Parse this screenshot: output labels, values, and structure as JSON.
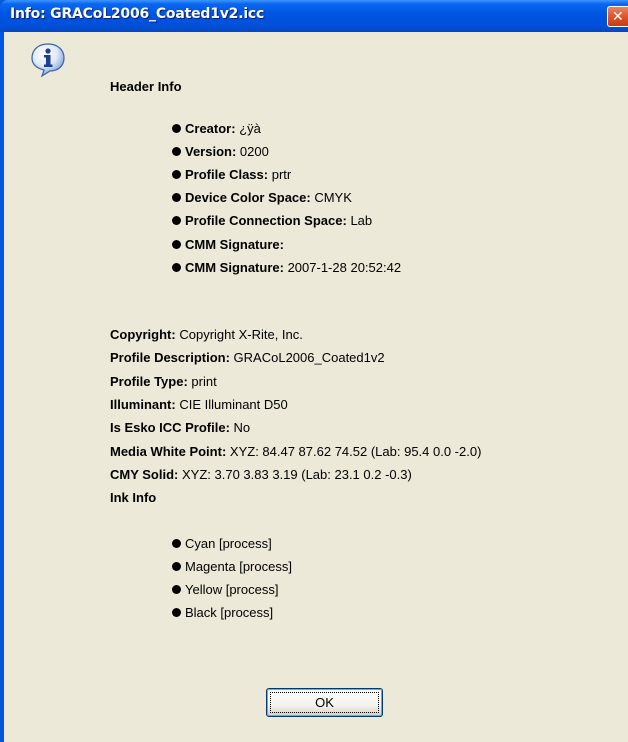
{
  "window": {
    "title": "Info: GRACoL2006_Coated1v2.icc",
    "close_glyph": "✕"
  },
  "header_info": {
    "heading": "Header Info",
    "items": [
      {
        "label": "Creator:",
        "value": "¿ÿà"
      },
      {
        "label": "Version:",
        "value": "0200"
      },
      {
        "label": "Profile Class:",
        "value": "prtr"
      },
      {
        "label": "Device Color Space:",
        "value": "CMYK"
      },
      {
        "label": "Profile Connection Space:",
        "value": "Lab"
      },
      {
        "label": "CMM Signature:",
        "value": ""
      },
      {
        "label": "CMM Signature:",
        "value": "2007-1-28 20:52:42"
      }
    ]
  },
  "details": [
    {
      "label": "Copyright:",
      "value": "Copyright X-Rite, Inc."
    },
    {
      "label": "Profile Description:",
      "value": "GRACoL2006_Coated1v2"
    },
    {
      "label": "Profile Type:",
      "value": "print"
    },
    {
      "label": "Illuminant:",
      "value": "CIE Illuminant D50"
    },
    {
      "label": "Is Esko ICC Profile:",
      "value": "No"
    },
    {
      "label": "Media White Point:",
      "value": "XYZ: 84.47 87.62 74.52 (Lab: 95.4 0.0 -2.0)"
    },
    {
      "label": "CMY Solid:",
      "value": "XYZ: 3.70 3.83 3.19 (Lab: 23.1 0.2 -0.3)"
    }
  ],
  "ink_info": {
    "heading": "Ink Info",
    "inks": [
      "Cyan [process]",
      "Magenta [process]",
      "Yellow [process]",
      "Black [process]"
    ]
  },
  "ok_button": {
    "label": "OK"
  },
  "icons": {
    "info": "info-icon",
    "close": "close-icon"
  },
  "colors": {
    "titlebar": "#0054e3",
    "client": "#ece9d8",
    "close": "#e0562b"
  }
}
